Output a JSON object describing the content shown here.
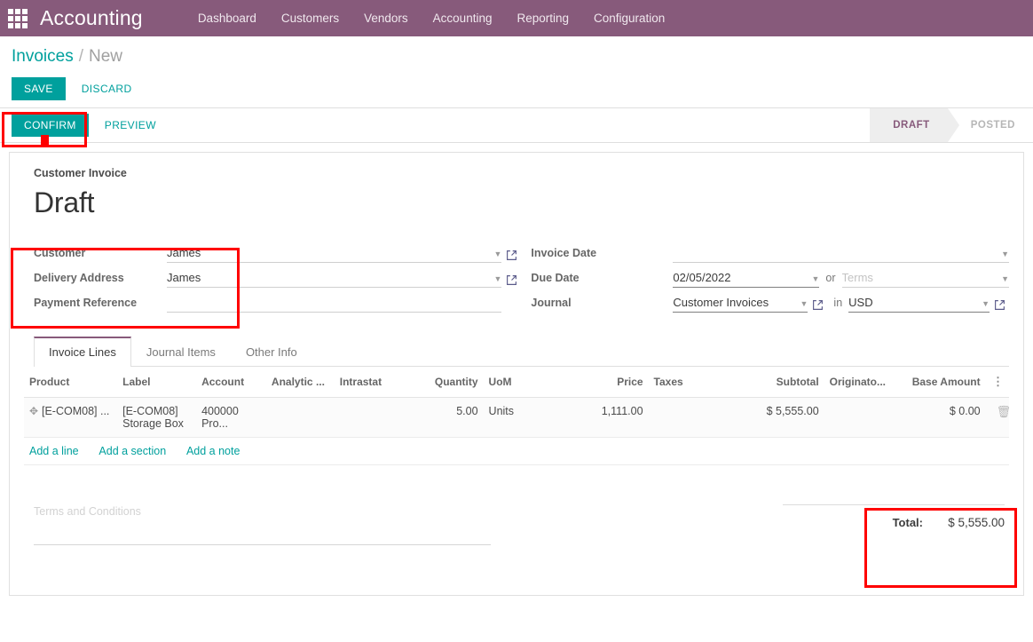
{
  "navbar": {
    "apps_icon": "apps-grid-icon",
    "brand": "Accounting",
    "menu": [
      {
        "label": "Dashboard"
      },
      {
        "label": "Customers"
      },
      {
        "label": "Vendors"
      },
      {
        "label": "Accounting"
      },
      {
        "label": "Reporting"
      },
      {
        "label": "Configuration"
      }
    ]
  },
  "breadcrumb": {
    "root": "Invoices",
    "separator": "/",
    "current": "New"
  },
  "actions": {
    "save": "SAVE",
    "discard": "DISCARD",
    "confirm": "CONFIRM",
    "preview": "PREVIEW"
  },
  "status": {
    "steps": [
      {
        "label": "DRAFT",
        "active": true
      },
      {
        "label": "POSTED",
        "active": false
      }
    ]
  },
  "sheet": {
    "subtitle": "Customer Invoice",
    "title": "Draft"
  },
  "form": {
    "left": [
      {
        "label": "Customer",
        "value": "James",
        "placeholder": "",
        "caret": true,
        "external_link": true
      },
      {
        "label": "Delivery Address",
        "value": "James",
        "placeholder": "",
        "caret": true,
        "external_link": true
      },
      {
        "label": "Payment Reference",
        "value": "",
        "placeholder": "",
        "caret": false,
        "external_link": false
      }
    ],
    "right": {
      "invoice_date": {
        "label": "Invoice Date",
        "value": "",
        "caret": true
      },
      "due_date": {
        "label": "Due Date",
        "value": "02/05/2022",
        "caret": true
      },
      "or_word": "or",
      "terms": {
        "value": "",
        "placeholder": "Terms",
        "caret": true
      },
      "journal": {
        "label": "Journal",
        "value": "Customer Invoices",
        "caret": true,
        "external_link": true
      },
      "in_word": "in",
      "currency": {
        "value": "USD",
        "caret": true,
        "external_link": true
      }
    }
  },
  "tabs": [
    {
      "label": "Invoice Lines",
      "active": true
    },
    {
      "label": "Journal Items",
      "active": false
    },
    {
      "label": "Other Info",
      "active": false
    }
  ],
  "lines_table": {
    "columns": [
      {
        "label": "Product",
        "align": "left"
      },
      {
        "label": "Label",
        "align": "left"
      },
      {
        "label": "Account",
        "align": "left"
      },
      {
        "label": "Analytic ...",
        "align": "left"
      },
      {
        "label": "Intrastat",
        "align": "left"
      },
      {
        "label": "Quantity",
        "align": "right"
      },
      {
        "label": "UoM",
        "align": "left"
      },
      {
        "label": "Price",
        "align": "right"
      },
      {
        "label": "Taxes",
        "align": "left"
      },
      {
        "label": "Subtotal",
        "align": "right"
      },
      {
        "label": "Originato...",
        "align": "left"
      },
      {
        "label": "Base Amount",
        "align": "right"
      }
    ],
    "options_icon": "kebab-menu-icon",
    "rows": [
      {
        "drag_icon": "drag-handle-icon",
        "product": "[E-COM08] ...",
        "label_line1": "[E-COM08]",
        "label_line2": "Storage Box",
        "account": "400000 Pro...",
        "analytic": "",
        "intrastat": "",
        "quantity": "5.00",
        "uom": "Units",
        "price": "1,111.00",
        "taxes": "",
        "subtotal": "$ 5,555.00",
        "originator": "",
        "base_amount": "$ 0.00",
        "delete_icon": "trash-icon"
      }
    ],
    "add_links": [
      {
        "label": "Add a line"
      },
      {
        "label": "Add a section"
      },
      {
        "label": "Add a note"
      }
    ]
  },
  "footer": {
    "terms_placeholder": "Terms and Conditions",
    "total_label": "Total:",
    "total_value": "$ 5,555.00"
  },
  "colors": {
    "brand_purple": "#875A7B",
    "accent_teal": "#00A09D",
    "annotation_red": "#ff0000",
    "status_active_bg": "#eeeeee"
  }
}
